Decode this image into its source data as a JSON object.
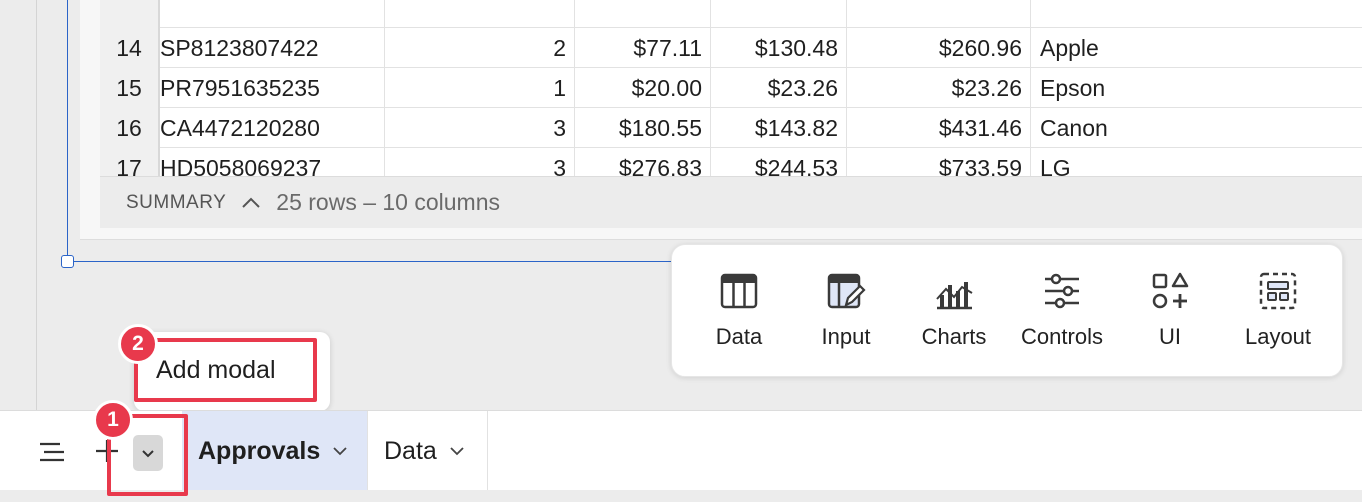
{
  "table": {
    "rows": [
      {
        "num": "14",
        "id": "SP8123807422",
        "qty": "2",
        "p1": "$77.11",
        "p2": "$130.48",
        "total": "$260.96",
        "brand": "Apple"
      },
      {
        "num": "15",
        "id": "PR7951635235",
        "qty": "1",
        "p1": "$20.00",
        "p2": "$23.26",
        "total": "$23.26",
        "brand": "Epson"
      },
      {
        "num": "16",
        "id": "CA4472120280",
        "qty": "3",
        "p1": "$180.55",
        "p2": "$143.82",
        "total": "$431.46",
        "brand": "Canon"
      },
      {
        "num": "17",
        "id": "HD5058069237",
        "qty": "3",
        "p1": "$276.83",
        "p2": "$244.53",
        "total": "$733.59",
        "brand": "LG"
      }
    ]
  },
  "summary": {
    "label": "SUMMARY",
    "count": "25 rows – 10 columns"
  },
  "element_panel": {
    "items": [
      {
        "label": "Data",
        "icon": "table-icon"
      },
      {
        "label": "Input",
        "icon": "input-table-icon"
      },
      {
        "label": "Charts",
        "icon": "chart-icon"
      },
      {
        "label": "Controls",
        "icon": "sliders-icon"
      },
      {
        "label": "UI",
        "icon": "shapes-icon"
      },
      {
        "label": "Layout",
        "icon": "layout-icon"
      }
    ]
  },
  "tooltip": {
    "text": "Add modal"
  },
  "callouts": {
    "one": "1",
    "two": "2"
  },
  "tabs": {
    "active": "Approvals",
    "second": "Data"
  },
  "colors": {
    "accent": "#2b64c8",
    "highlight": "#e8394c",
    "active_tab": "#dfe6f7"
  }
}
